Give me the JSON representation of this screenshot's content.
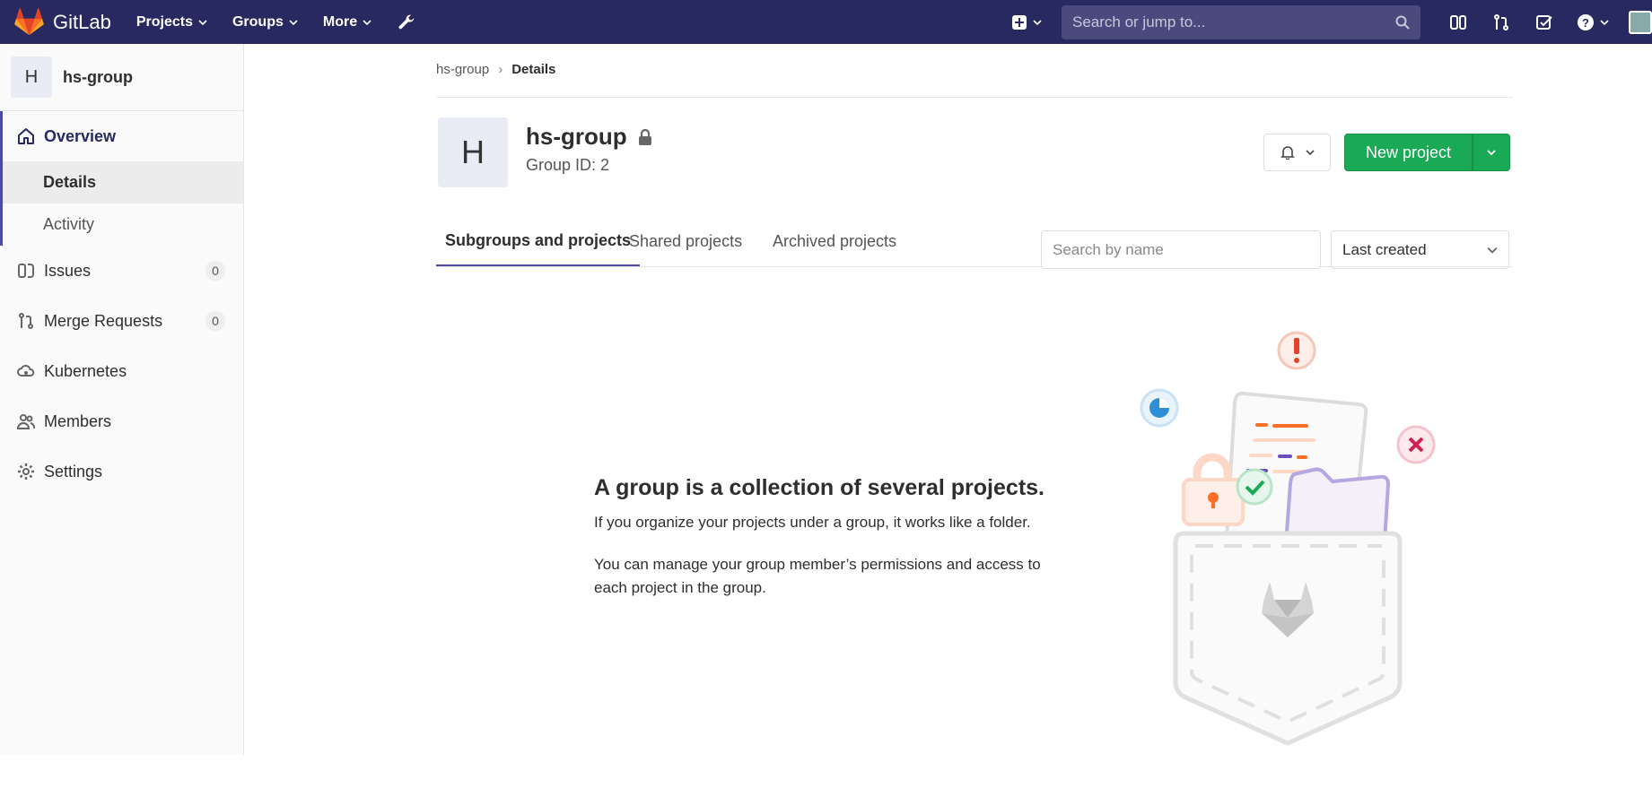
{
  "topbar": {
    "brand": "GitLab",
    "nav": [
      "Projects",
      "Groups",
      "More"
    ],
    "search_placeholder": "Search or jump to..."
  },
  "sidebar": {
    "avatar_letter": "H",
    "title": "hs-group",
    "overview": "Overview",
    "subitems": [
      "Details",
      "Activity"
    ],
    "issues": {
      "label": "Issues",
      "count": "0"
    },
    "merge_requests": {
      "label": "Merge Requests",
      "count": "0"
    },
    "kubernetes": "Kubernetes",
    "members": "Members",
    "settings": "Settings"
  },
  "breadcrumb": {
    "parent": "hs-group",
    "current": "Details"
  },
  "group": {
    "avatar_letter": "H",
    "name": "hs-group",
    "id_text": "Group ID: 2"
  },
  "actions": {
    "new_project": "New project"
  },
  "tabs": [
    "Subgroups and projects",
    "Shared projects",
    "Archived projects"
  ],
  "filter": {
    "placeholder": "Search by name",
    "sort": "Last created"
  },
  "empty_state": {
    "title": "A group is a collection of several projects.",
    "p1": "If you organize your projects under a group, it works like a folder.",
    "p2": "You can manage your group member’s permissions and access to each project in the group."
  },
  "colors": {
    "nav": "#292961",
    "primary": "#1aaa55",
    "accent": "#4b4ba3"
  }
}
